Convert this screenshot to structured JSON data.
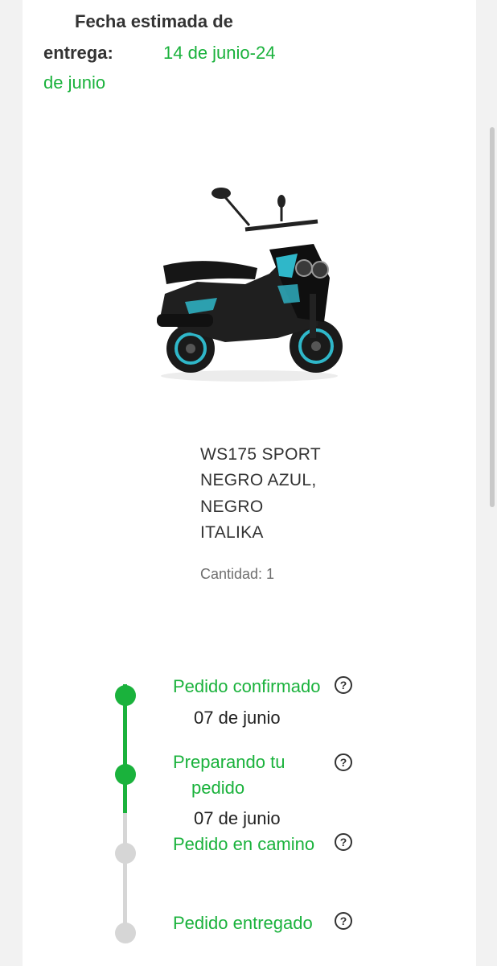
{
  "delivery": {
    "label_line1": "Fecha estimada de",
    "label_line2": "entrega:",
    "value_line1": "14 de junio-24",
    "value_line2": "de junio"
  },
  "product": {
    "name_line1": "WS175 SPORT",
    "name_line2": "NEGRO AZUL,",
    "name_line3": "NEGRO",
    "name_line4": "ITALIKA",
    "quantity": "Cantidad: 1"
  },
  "tracking": {
    "steps": [
      {
        "label": "Pedido confirmado",
        "date": "07 de junio",
        "status": "done",
        "help": "?"
      },
      {
        "label_line1": "Preparando tu",
        "label_line2": "pedido",
        "date": "07 de junio",
        "status": "done",
        "help": "?"
      },
      {
        "label": "Pedido en camino",
        "status": "pending",
        "help": "?"
      },
      {
        "label": "Pedido entregado",
        "status": "pending",
        "help": "?"
      }
    ]
  },
  "colors": {
    "accent": "#1ab23c",
    "pending": "#d6d6d6",
    "text": "#333333"
  }
}
